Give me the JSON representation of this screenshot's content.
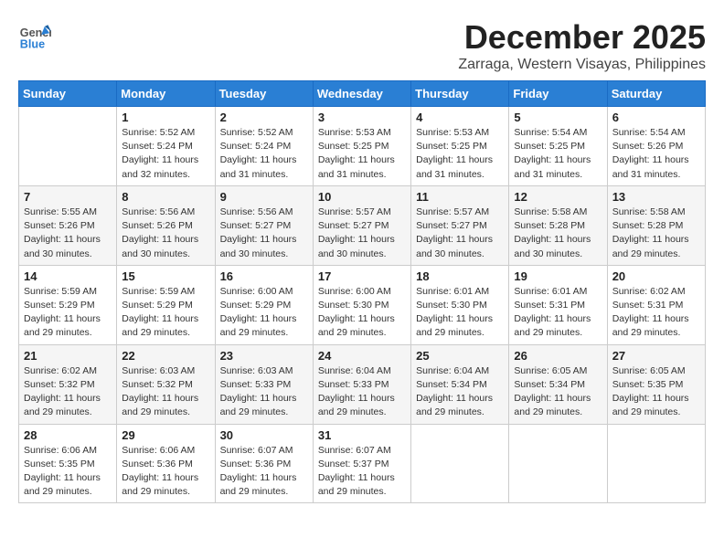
{
  "header": {
    "logo_general": "General",
    "logo_blue": "Blue",
    "month_year": "December 2025",
    "location": "Zarraga, Western Visayas, Philippines"
  },
  "days_of_week": [
    "Sunday",
    "Monday",
    "Tuesday",
    "Wednesday",
    "Thursday",
    "Friday",
    "Saturday"
  ],
  "weeks": [
    [
      {
        "day": "",
        "info": ""
      },
      {
        "day": "1",
        "info": "Sunrise: 5:52 AM\nSunset: 5:24 PM\nDaylight: 11 hours\nand 32 minutes."
      },
      {
        "day": "2",
        "info": "Sunrise: 5:52 AM\nSunset: 5:24 PM\nDaylight: 11 hours\nand 31 minutes."
      },
      {
        "day": "3",
        "info": "Sunrise: 5:53 AM\nSunset: 5:25 PM\nDaylight: 11 hours\nand 31 minutes."
      },
      {
        "day": "4",
        "info": "Sunrise: 5:53 AM\nSunset: 5:25 PM\nDaylight: 11 hours\nand 31 minutes."
      },
      {
        "day": "5",
        "info": "Sunrise: 5:54 AM\nSunset: 5:25 PM\nDaylight: 11 hours\nand 31 minutes."
      },
      {
        "day": "6",
        "info": "Sunrise: 5:54 AM\nSunset: 5:26 PM\nDaylight: 11 hours\nand 31 minutes."
      }
    ],
    [
      {
        "day": "7",
        "info": "Sunrise: 5:55 AM\nSunset: 5:26 PM\nDaylight: 11 hours\nand 30 minutes."
      },
      {
        "day": "8",
        "info": "Sunrise: 5:56 AM\nSunset: 5:26 PM\nDaylight: 11 hours\nand 30 minutes."
      },
      {
        "day": "9",
        "info": "Sunrise: 5:56 AM\nSunset: 5:27 PM\nDaylight: 11 hours\nand 30 minutes."
      },
      {
        "day": "10",
        "info": "Sunrise: 5:57 AM\nSunset: 5:27 PM\nDaylight: 11 hours\nand 30 minutes."
      },
      {
        "day": "11",
        "info": "Sunrise: 5:57 AM\nSunset: 5:27 PM\nDaylight: 11 hours\nand 30 minutes."
      },
      {
        "day": "12",
        "info": "Sunrise: 5:58 AM\nSunset: 5:28 PM\nDaylight: 11 hours\nand 30 minutes."
      },
      {
        "day": "13",
        "info": "Sunrise: 5:58 AM\nSunset: 5:28 PM\nDaylight: 11 hours\nand 29 minutes."
      }
    ],
    [
      {
        "day": "14",
        "info": "Sunrise: 5:59 AM\nSunset: 5:29 PM\nDaylight: 11 hours\nand 29 minutes."
      },
      {
        "day": "15",
        "info": "Sunrise: 5:59 AM\nSunset: 5:29 PM\nDaylight: 11 hours\nand 29 minutes."
      },
      {
        "day": "16",
        "info": "Sunrise: 6:00 AM\nSunset: 5:29 PM\nDaylight: 11 hours\nand 29 minutes."
      },
      {
        "day": "17",
        "info": "Sunrise: 6:00 AM\nSunset: 5:30 PM\nDaylight: 11 hours\nand 29 minutes."
      },
      {
        "day": "18",
        "info": "Sunrise: 6:01 AM\nSunset: 5:30 PM\nDaylight: 11 hours\nand 29 minutes."
      },
      {
        "day": "19",
        "info": "Sunrise: 6:01 AM\nSunset: 5:31 PM\nDaylight: 11 hours\nand 29 minutes."
      },
      {
        "day": "20",
        "info": "Sunrise: 6:02 AM\nSunset: 5:31 PM\nDaylight: 11 hours\nand 29 minutes."
      }
    ],
    [
      {
        "day": "21",
        "info": "Sunrise: 6:02 AM\nSunset: 5:32 PM\nDaylight: 11 hours\nand 29 minutes."
      },
      {
        "day": "22",
        "info": "Sunrise: 6:03 AM\nSunset: 5:32 PM\nDaylight: 11 hours\nand 29 minutes."
      },
      {
        "day": "23",
        "info": "Sunrise: 6:03 AM\nSunset: 5:33 PM\nDaylight: 11 hours\nand 29 minutes."
      },
      {
        "day": "24",
        "info": "Sunrise: 6:04 AM\nSunset: 5:33 PM\nDaylight: 11 hours\nand 29 minutes."
      },
      {
        "day": "25",
        "info": "Sunrise: 6:04 AM\nSunset: 5:34 PM\nDaylight: 11 hours\nand 29 minutes."
      },
      {
        "day": "26",
        "info": "Sunrise: 6:05 AM\nSunset: 5:34 PM\nDaylight: 11 hours\nand 29 minutes."
      },
      {
        "day": "27",
        "info": "Sunrise: 6:05 AM\nSunset: 5:35 PM\nDaylight: 11 hours\nand 29 minutes."
      }
    ],
    [
      {
        "day": "28",
        "info": "Sunrise: 6:06 AM\nSunset: 5:35 PM\nDaylight: 11 hours\nand 29 minutes."
      },
      {
        "day": "29",
        "info": "Sunrise: 6:06 AM\nSunset: 5:36 PM\nDaylight: 11 hours\nand 29 minutes."
      },
      {
        "day": "30",
        "info": "Sunrise: 6:07 AM\nSunset: 5:36 PM\nDaylight: 11 hours\nand 29 minutes."
      },
      {
        "day": "31",
        "info": "Sunrise: 6:07 AM\nSunset: 5:37 PM\nDaylight: 11 hours\nand 29 minutes."
      },
      {
        "day": "",
        "info": ""
      },
      {
        "day": "",
        "info": ""
      },
      {
        "day": "",
        "info": ""
      }
    ]
  ]
}
